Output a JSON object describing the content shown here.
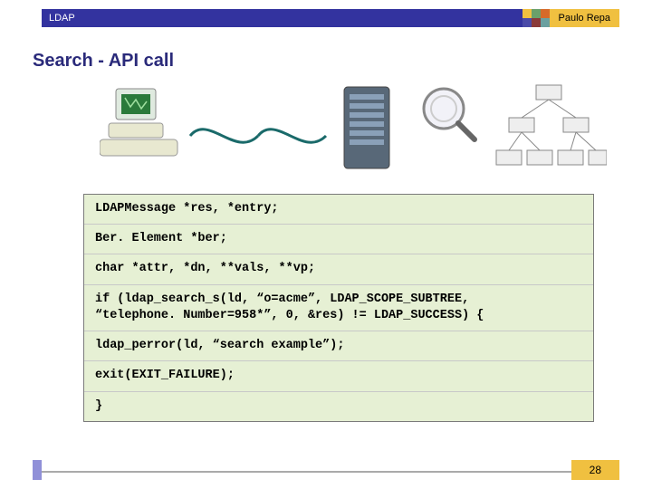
{
  "header": {
    "label": "LDAP",
    "author": "Paulo Repa",
    "swatch_colors": [
      "#f0c040",
      "#6aa06a",
      "#d66a2a",
      "#4a4aa8",
      "#8a3a3a",
      "#6aa0a0"
    ]
  },
  "title": "Search - API call",
  "code": {
    "l1": "LDAPMessage *res, *entry;",
    "l2": "Ber. Element *ber;",
    "l3": "char *attr, *dn, **vals, **vp;",
    "l4a": "if (ldap_search_s(ld, “o=acme”, LDAP_SCOPE_SUBTREE,",
    "l4b": "“telephone. Number=958*”, 0, &res) != LDAP_SUCCESS) {",
    "l5": "ldap_perror(ld, “search example”);",
    "l6": "exit(EXIT_FAILURE);",
    "l7": "}"
  },
  "footer": {
    "page": "28"
  }
}
